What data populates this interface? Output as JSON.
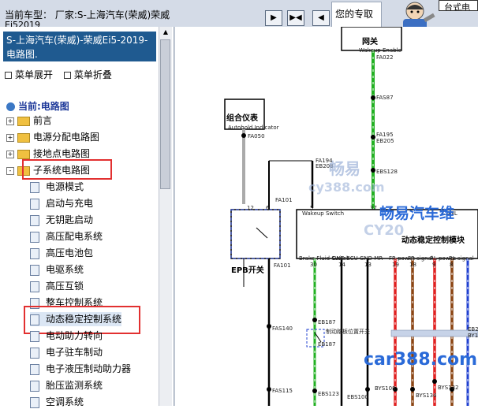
{
  "topbar": {
    "car_label_line1": "当前车型： 厂家:S-上海汽车(荣威)荣威",
    "car_label_line2": "Ei52019",
    "nav_buttons": [
      "▶",
      "▶◀",
      "◀"
    ],
    "reminder_text": "您的专取",
    "top_right_text": "台式电"
  },
  "sidebar": {
    "title": "S-上海汽车(荣威)-荣威Ei5-2019- 电路图.",
    "menu_expand": "菜单展开",
    "menu_collapse": "菜单折叠",
    "current_label": "当前:电路图",
    "folders": [
      {
        "label": "前言",
        "state": "+"
      },
      {
        "label": "电源分配电路图",
        "state": "+"
      },
      {
        "label": "接地点电路图",
        "state": "+"
      },
      {
        "label": "子系统电路图",
        "state": "-"
      }
    ],
    "items": [
      "电源模式",
      "启动与充电",
      "无钥匙启动",
      "高压配电系统",
      "高压电池包",
      "电驱系统",
      "高压互锁",
      "整车控制系统",
      "动态稳定控制系统",
      "电动助力转向",
      "电子驻车制动",
      "电子液压制动助力器",
      "胎压监测系统",
      "空调系统"
    ],
    "selected_item": "动态稳定控制系统"
  },
  "diagram": {
    "modules": {
      "gateway": "网关",
      "cluster": "组合仪表",
      "epb": "EPB开关",
      "esc": "动态稳定控制模块",
      "brake_switch": "制动踏板位置开关"
    },
    "connector_labels": [
      "FA022",
      "FAS87",
      "FA195",
      "EB205",
      "EBS128",
      "FA050",
      "FA194",
      "EB208",
      "FA101",
      "FAS140",
      "EB187",
      "EBS123",
      "EBS100",
      "BYS108",
      "BYS134",
      "BYS132",
      "FAS115",
      "EB20",
      "BY15"
    ],
    "small_labels": [
      "Wakeup Enable",
      "Autohold Indicator",
      "Wakeup Switch",
      "CANL",
      "Brake Fluid Switch",
      "GND ECU",
      "GND MR",
      "FR power",
      "FR signal",
      "RL power",
      "RL signal"
    ],
    "pin_numbers": [
      "12",
      "6",
      "5",
      "37",
      "30",
      "14",
      "13",
      "19",
      "18",
      "9",
      "8"
    ],
    "watermarks": [
      "畅易",
      "CY20",
      "cy388.com",
      "畅易汽车维",
      "car388.com"
    ]
  },
  "colors": {
    "sidebar_title_bg": "#1f5a90",
    "highlight": "#e23030",
    "current_label": "#1f3a9a",
    "wire_green": "#22b022",
    "wire_red": "#e02020",
    "wire_brown": "#8b4513",
    "wire_blue": "#2040d0",
    "watermark_blue": "#2a6ad8"
  }
}
